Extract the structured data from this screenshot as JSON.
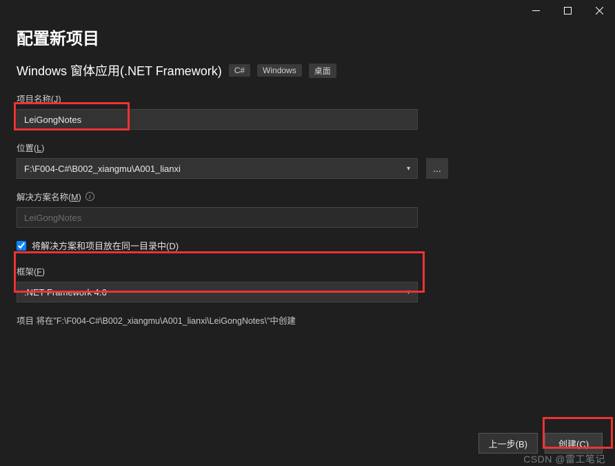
{
  "window": {
    "min_icon": "minimize",
    "max_icon": "maximize",
    "close_icon": "close"
  },
  "header": {
    "title": "配置新项目",
    "subtitle": "Windows 窗体应用(.NET Framework)",
    "tags": [
      "C#",
      "Windows",
      "桌面"
    ]
  },
  "fields": {
    "project_name": {
      "label_main": "项目名称(",
      "label_key": "J",
      "label_end": ")",
      "value": "LeiGongNotes"
    },
    "location": {
      "label_main": "位置(",
      "label_key": "L",
      "label_end": ")",
      "value": "F:\\F004-C#\\B002_xiangmu\\A001_lianxi",
      "browse_label": "..."
    },
    "solution_name": {
      "label_main": "解决方案名称(",
      "label_key": "M",
      "label_end": ")",
      "value": "LeiGongNotes"
    },
    "same_dir_checkbox": {
      "label_pre": "将解决方案和项目放在同一目录中(",
      "label_key": "D",
      "label_end": ")",
      "checked": true
    },
    "framework": {
      "label_main": "框架(",
      "label_key": "F",
      "label_end": ")",
      "value": ".NET Framework 4.6"
    }
  },
  "info_line": "项目 将在\"F:\\F004-C#\\B002_xiangmu\\A001_lianxi\\LeiGongNotes\\\"中创建",
  "footer": {
    "back": {
      "pre": "上一步(",
      "key": "B",
      "end": ")"
    },
    "create": {
      "pre": "创建(",
      "key": "C",
      "end": ")"
    }
  },
  "watermark": "CSDN @雷工笔记"
}
